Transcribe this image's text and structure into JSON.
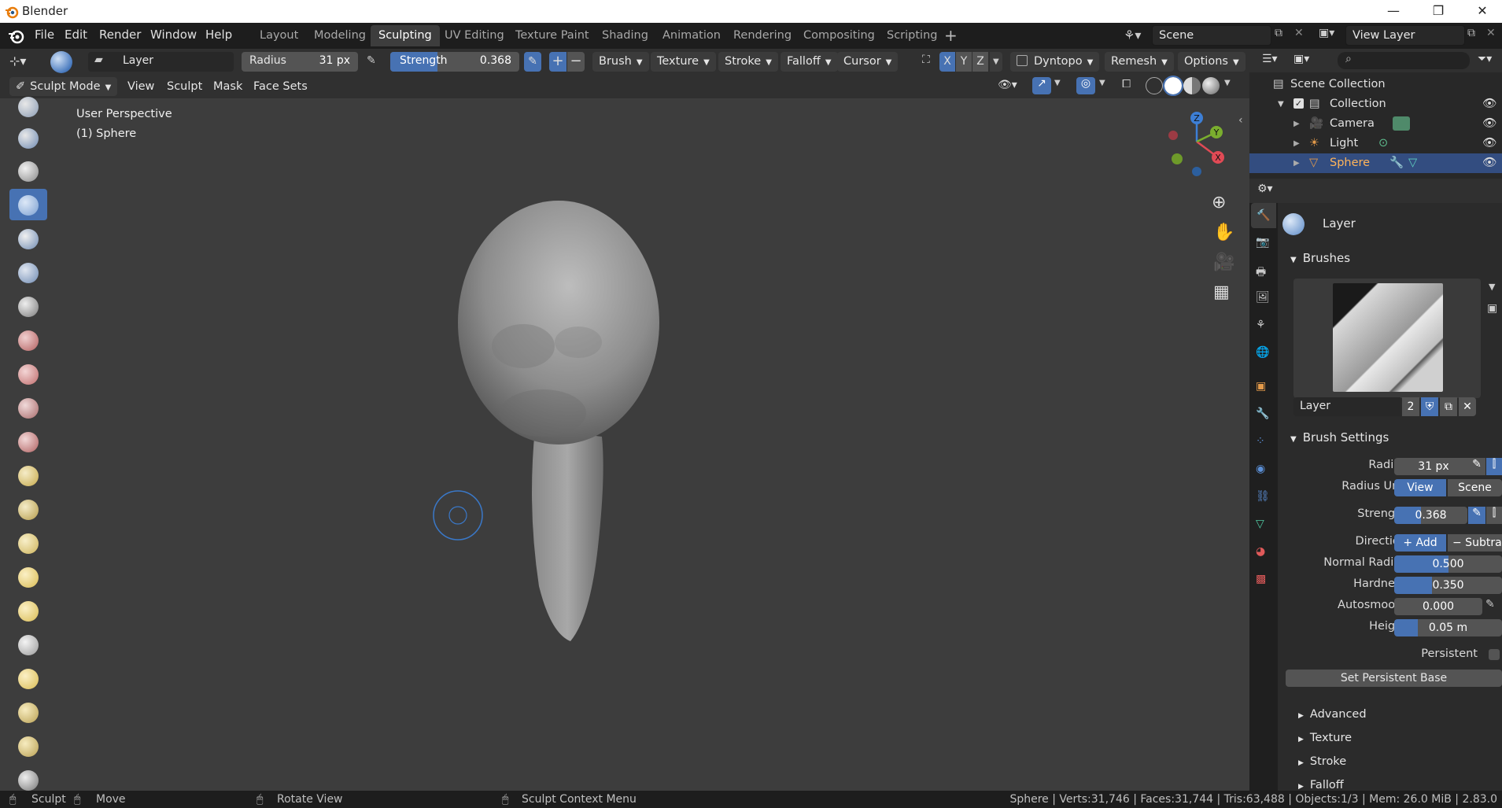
{
  "window": {
    "app_title": "Blender"
  },
  "menu": {
    "file": "File",
    "edit": "Edit",
    "render": "Render",
    "window": "Window",
    "help": "Help"
  },
  "workspaces": [
    "Layout",
    "Modeling",
    "Sculpting",
    "UV Editing",
    "Texture Paint",
    "Shading",
    "Animation",
    "Rendering",
    "Compositing",
    "Scripting"
  ],
  "active_workspace": "Sculpting",
  "add_workspace_icon": "+",
  "scene": {
    "name": "Scene"
  },
  "view_layer": {
    "name": "View Layer"
  },
  "tool_header": {
    "brush_name": "Layer",
    "radius_label": "Radius",
    "radius_value": "31 px",
    "strength_label": "Strength",
    "strength_value": "0.368",
    "strength_fraction": 0.368,
    "add_symbol": "+",
    "sub_symbol": "−",
    "brush_menu": "Brush",
    "texture_menu": "Texture",
    "stroke_menu": "Stroke",
    "falloff_menu": "Falloff",
    "cursor_menu": "Cursor",
    "axis_x": "X",
    "axis_y": "Y",
    "axis_z": "Z",
    "dyntopo": "Dyntopo",
    "remesh": "Remesh",
    "options": "Options"
  },
  "mode_header": {
    "mode": "Sculpt Mode",
    "view": "View",
    "sculpt": "Sculpt",
    "mask": "Mask",
    "face_sets": "Face Sets"
  },
  "viewport": {
    "perspective": "User Perspective",
    "object": "(1) Sphere"
  },
  "gizmo": {
    "x": "X",
    "y": "Y",
    "z": "Z"
  },
  "outliner": {
    "scene_collection": "Scene Collection",
    "collection": "Collection",
    "items": [
      {
        "label": "Camera"
      },
      {
        "label": "Light"
      },
      {
        "label": "Sphere"
      }
    ]
  },
  "properties": {
    "brush_name": "Layer",
    "brushes_section": "Brushes",
    "brush_field_name": "Layer",
    "brush_users": "2",
    "brush_settings_section": "Brush Settings",
    "radius_label": "Radius",
    "radius_value": "31 px",
    "radius_unit_label": "Radius Unit",
    "radius_unit_view": "View",
    "radius_unit_scene": "Scene",
    "strength_label": "Strength",
    "strength_value": "0.368",
    "strength_fraction": 0.368,
    "direction_label": "Direction",
    "direction_add": "+  Add",
    "direction_sub": "− Subtra",
    "normal_radius_label": "Normal Radius",
    "normal_radius_value": "0.500",
    "normal_radius_fraction": 0.5,
    "hardness_label": "Hardness",
    "hardness_value": "0.350",
    "hardness_fraction": 0.35,
    "autosmooth_label": "Autosmooth",
    "autosmooth_value": "0.000",
    "autosmooth_fraction": 0,
    "height_label": "Height",
    "height_value": "0.05 m",
    "height_fraction": 0.05,
    "persistent_label": "Persistent",
    "set_persistent_base": "Set Persistent Base",
    "sub_sections": [
      "Advanced",
      "Texture",
      "Stroke",
      "Falloff"
    ]
  },
  "status": {
    "sculpt": "Sculpt",
    "move": "Move",
    "rotate_view": "Rotate View",
    "context_menu": "Sculpt Context Menu",
    "stats": "Sphere | Verts:31,746 | Faces:31,744 | Tris:63,488 | Objects:1/3 | Mem: 26.0 MiB | 2.83.0"
  },
  "colors": {
    "accent": "#4772b3",
    "selected_row": "#334d80",
    "panel": "#2b2b2b",
    "viewport": "#3d3d3d"
  }
}
